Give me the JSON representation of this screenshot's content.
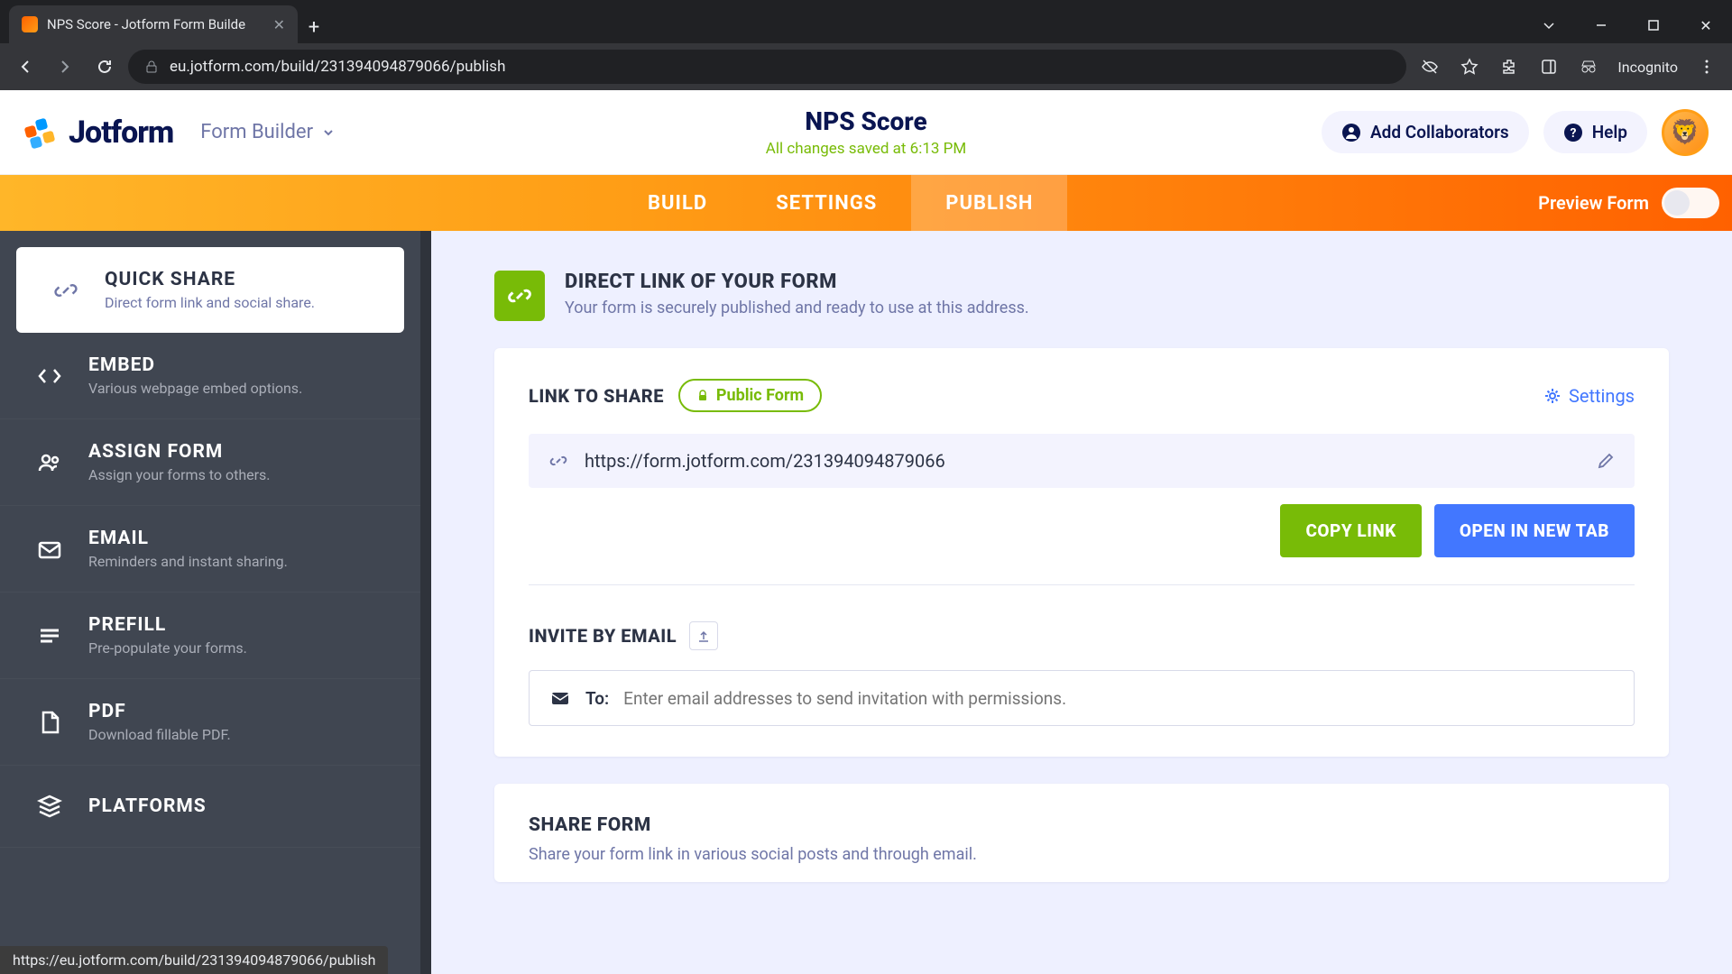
{
  "browser": {
    "tab_title": "NPS Score - Jotform Form Builde",
    "url": "eu.jotform.com/build/231394094879066/publish",
    "incognito": "Incognito",
    "status_bar": "https://eu.jotform.com/build/231394094879066/publish"
  },
  "header": {
    "logo_text": "Jotform",
    "form_builder": "Form Builder",
    "form_title": "NPS Score",
    "saved": "All changes saved at 6:13 PM",
    "add_collab": "Add Collaborators",
    "help": "Help"
  },
  "tabs": {
    "build": "BUILD",
    "settings": "SETTINGS",
    "publish": "PUBLISH",
    "preview": "Preview Form"
  },
  "sidebar": {
    "items": [
      {
        "title": "QUICK SHARE",
        "desc": "Direct form link and social share."
      },
      {
        "title": "EMBED",
        "desc": "Various webpage embed options."
      },
      {
        "title": "ASSIGN FORM",
        "desc": "Assign your forms to others."
      },
      {
        "title": "EMAIL",
        "desc": "Reminders and instant sharing."
      },
      {
        "title": "PREFILL",
        "desc": "Pre-populate your forms."
      },
      {
        "title": "PDF",
        "desc": "Download fillable PDF."
      },
      {
        "title": "PLATFORMS",
        "desc": ""
      }
    ]
  },
  "main": {
    "direct_link_title": "DIRECT LINK OF YOUR FORM",
    "direct_link_sub": "Your form is securely published and ready to use at this address.",
    "link_to_share": "LINK TO SHARE",
    "public_form": "Public Form",
    "settings": "Settings",
    "form_url": "https://form.jotform.com/231394094879066",
    "copy_link": "COPY LINK",
    "open_tab": "OPEN IN NEW TAB",
    "invite_label": "INVITE BY EMAIL",
    "to": "To:",
    "email_placeholder": "Enter email addresses to send invitation with permissions.",
    "share_form_title": "SHARE FORM",
    "share_form_sub": "Share your form link in various social posts and through email."
  }
}
